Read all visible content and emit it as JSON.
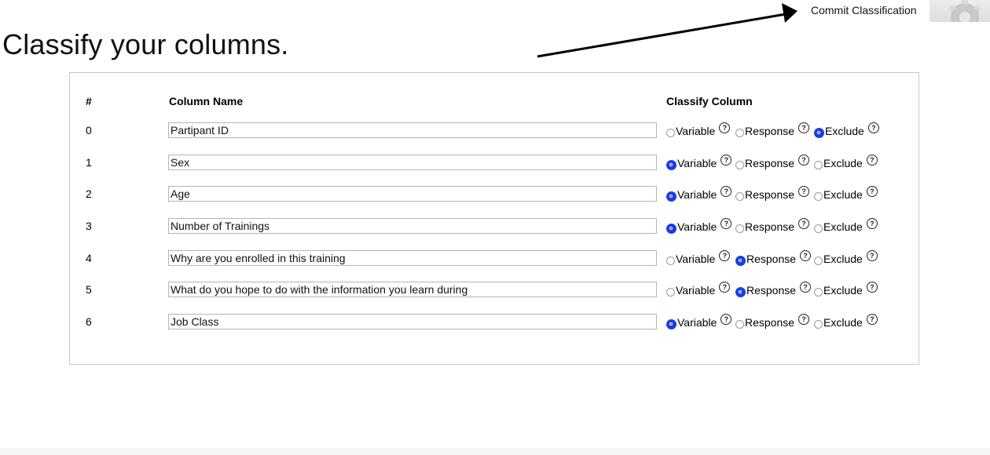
{
  "header": {
    "title": "Classify your columns.",
    "commit_label": "Commit Classification"
  },
  "table": {
    "col_num": "#",
    "col_name": "Column Name",
    "col_classify": "Classify Column",
    "option_labels": {
      "variable": "Variable",
      "response": "Response",
      "exclude": "Exclude"
    },
    "rows": [
      {
        "num": "0",
        "name": "Partipant ID",
        "selected": "exclude"
      },
      {
        "num": "1",
        "name": "Sex",
        "selected": "variable"
      },
      {
        "num": "2",
        "name": "Age",
        "selected": "variable"
      },
      {
        "num": "3",
        "name": "Number of Trainings",
        "selected": "variable"
      },
      {
        "num": "4",
        "name": "Why are you enrolled in this training",
        "selected": "response"
      },
      {
        "num": "5",
        "name": "What do you hope to do with the information you learn during",
        "selected": "response"
      },
      {
        "num": "6",
        "name": "Job Class",
        "selected": "variable"
      }
    ]
  },
  "icons": {
    "help": "help-circle-icon",
    "settings": "gear-icon",
    "pointer": "arrow-icon"
  },
  "colors": {
    "radio_selected": "#1a3fe0",
    "panel_border": "#c8c8c8"
  }
}
